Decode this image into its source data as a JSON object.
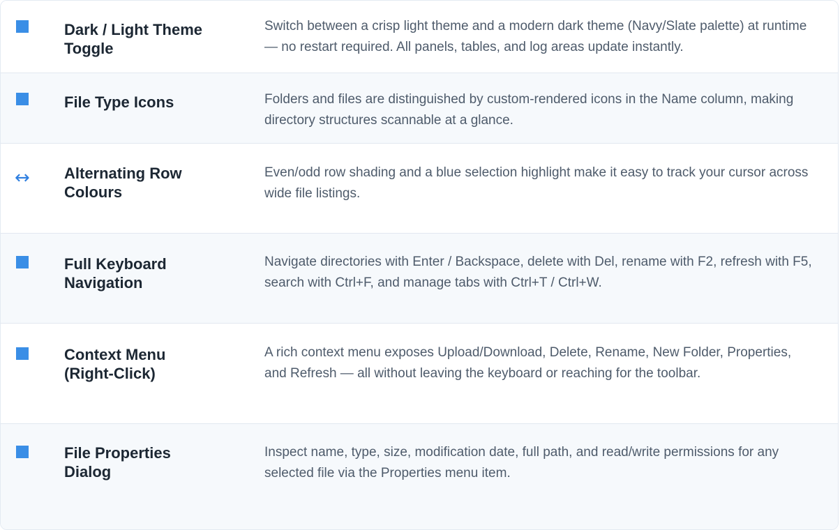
{
  "features": [
    {
      "icon": "blue-square-icon",
      "title_line1": "Dark / Light Theme",
      "title_line2": "Toggle",
      "description": "Switch between a crisp light theme and a modern dark theme (Navy/Slate palette) at runtime — no restart required. All panels, tables, and log areas update instantly."
    },
    {
      "icon": "blue-square-icon",
      "title_line1": "File Type Icons",
      "title_line2": "",
      "description": "Folders and files are distinguished by custom-rendered icons in the Name column, making directory structures scannable at a glance."
    },
    {
      "icon": "left-right-arrow-icon",
      "icon_glyph": "↔",
      "title_line1": "Alternating Row",
      "title_line2": "Colours",
      "description": "Even/odd row shading and a blue selection highlight make it easy to track your cursor across wide file listings."
    },
    {
      "icon": "blue-square-icon",
      "title_line1": "Full Keyboard",
      "title_line2": "Navigation",
      "description": "Navigate directories with Enter / Backspace, delete with Del, rename with F2, refresh with F5, search with Ctrl+F, and manage tabs with Ctrl+T / Ctrl+W."
    },
    {
      "icon": "blue-square-icon",
      "title_line1": "Context Menu",
      "title_line2": "(Right-Click)",
      "description": "A rich context menu exposes Upload/Download, Delete, Rename, New Folder, Properties, and Refresh — all without leaving the keyboard or reaching for the toolbar."
    },
    {
      "icon": "blue-square-icon",
      "title_line1": "File Properties",
      "title_line2": "Dialog",
      "description": "Inspect name, type, size, modification date, full path, and read/write permissions for any selected file via the Properties menu item."
    }
  ],
  "colors": {
    "accent": "#3a8ee6",
    "row_alt": "#f6f9fc",
    "title": "#1c2733",
    "description": "#4e5b6b"
  }
}
